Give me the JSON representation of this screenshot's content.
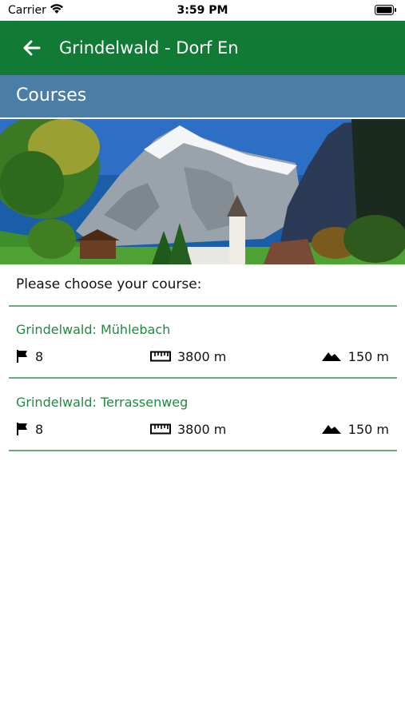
{
  "status_bar": {
    "carrier": "Carrier",
    "time": "3:59 PM"
  },
  "app_bar": {
    "title": "Grindelwald - Dorf En"
  },
  "section": {
    "title": "Courses"
  },
  "prompt": "Please choose your course:",
  "courses": [
    {
      "name": "Grindelwald: Mühlebach",
      "holes": "8",
      "length": "3800 m",
      "elevation": "150 m"
    },
    {
      "name": "Grindelwald: Terrassenweg",
      "holes": "8",
      "length": "3800 m",
      "elevation": "150 m"
    }
  ],
  "colors": {
    "app_bar": "#117a35",
    "section_header": "#4b7ea7",
    "course_name": "#1e8a3f",
    "divider": "#6aaa7c"
  },
  "icons": [
    "back-arrow-icon",
    "wifi-icon",
    "battery-icon",
    "flag-icon",
    "ruler-icon",
    "mountain-icon"
  ]
}
